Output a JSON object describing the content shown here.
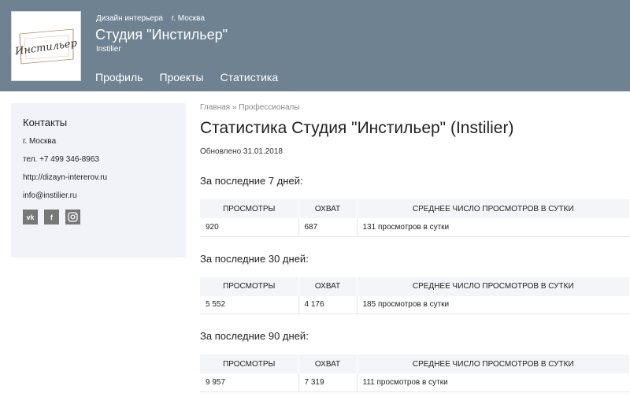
{
  "header": {
    "category": "Дизайн интерьера",
    "city": "г. Москва",
    "studio_name": "Студия \"Инстильер\"",
    "studio_latin": "Instilier",
    "logo_text": "Инстильер",
    "nav": [
      "Профиль",
      "Проекты",
      "Статистика"
    ]
  },
  "sidebar": {
    "title": "Контакты",
    "city": "г. Москва",
    "phone": "тел. +7 499 346-8963",
    "site": "http://dizayn-intererov.ru",
    "email": "info@instilier.ru",
    "social": [
      "vk-icon",
      "facebook-icon",
      "instagram-icon"
    ]
  },
  "main": {
    "breadcrumb_home": "Главная",
    "breadcrumb_sep": "»",
    "breadcrumb_section": "Профессионалы",
    "title": "Статистика Студия \"Инстильер\" (Instilier)",
    "updated": "Обновлено 31.01.2018",
    "columns": [
      "ПРОСМОТРЫ",
      "ОХВАТ",
      "СРЕДНЕЕ ЧИСЛО ПРОСМОТРОВ В СУТКИ"
    ],
    "periods": [
      {
        "label": "За последние 7 дней:",
        "views": "920",
        "reach": "687",
        "avg": "131 просмотров в сутки"
      },
      {
        "label": "За последние 30 дней:",
        "views": "5 552",
        "reach": "4 176",
        "avg": "185 просмотров в сутки"
      },
      {
        "label": "За последние 90 дней:",
        "views": "9 957",
        "reach": "7 319",
        "avg": "111 просмотров в сутки"
      }
    ]
  }
}
